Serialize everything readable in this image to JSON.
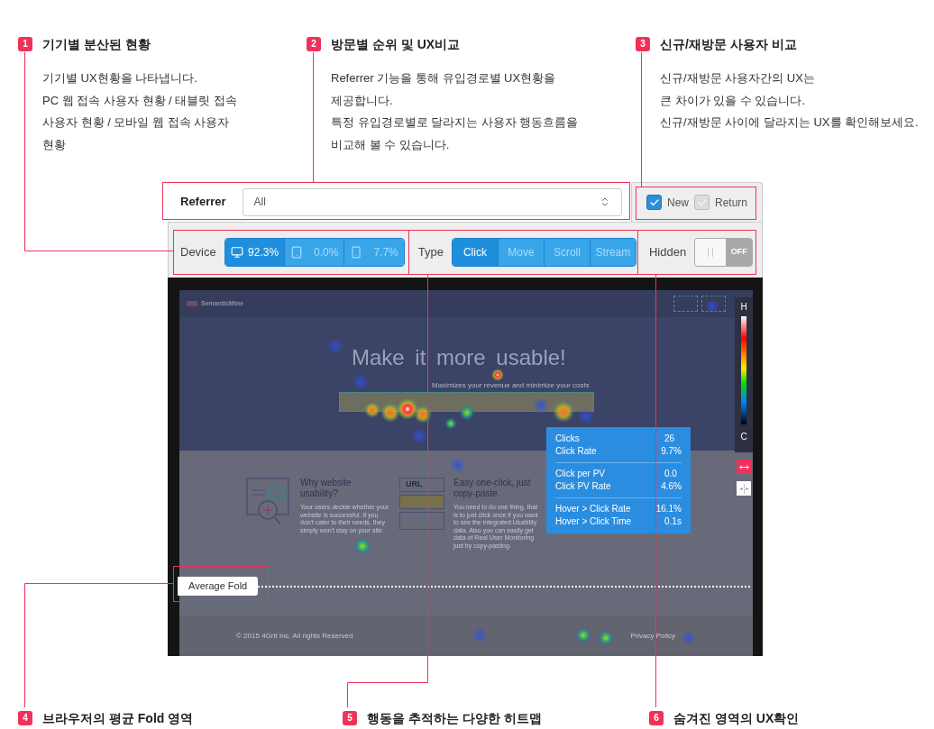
{
  "annotations_top": [
    {
      "number": "1",
      "title": "기기별 분산된 현황",
      "lines": [
        "기기별 UX현황을 나타냅니다.",
        "PC 웹 접속 사용자 현황 / 태블릿 접속",
        "사용자 현황 / 모바일 웹 접속 사용자",
        "현황"
      ]
    },
    {
      "number": "2",
      "title": "방문별 순위 및 UX비교",
      "lines": [
        "Referrer 기능을 통해 유입경로별 UX현황을",
        "제공합니다.",
        "특정 유입경로별로 달라지는 사용자 행동흐름을",
        "비교해 볼 수 있습니다."
      ]
    },
    {
      "number": "3",
      "title": "신규/재방문 사용자 비교",
      "lines": [
        "신규/재방문 사용자간의 UX는",
        "큰 차이가 있을 수 있습니다.",
        "신규/재방문 사이에 달라지는 UX를 확인해보세요."
      ]
    }
  ],
  "controls": {
    "referrer": {
      "label": "Referrer",
      "value": "All"
    },
    "visitors": [
      {
        "label": "New",
        "checked": true
      },
      {
        "label": "Return",
        "checked": false
      }
    ],
    "device": {
      "label": "Device",
      "options": [
        {
          "kind": "desktop",
          "value": "92.3%",
          "selected": true
        },
        {
          "kind": "tablet",
          "value": "0.0%",
          "selected": false
        },
        {
          "kind": "mobile",
          "value": "7.7%",
          "selected": false
        }
      ]
    },
    "type": {
      "label": "Type",
      "options": [
        {
          "label": "Click",
          "selected": true
        },
        {
          "label": "Move",
          "selected": false
        },
        {
          "label": "Scroll",
          "selected": false
        },
        {
          "label": "Stream",
          "selected": false
        }
      ]
    },
    "hidden": {
      "label": "Hidden",
      "on": false,
      "state_text": "OFF"
    }
  },
  "heatmap": {
    "page": {
      "brand": "SemanticMine",
      "headline": "Make it more usable!",
      "subline": "Maximizes your revenue and minimize your costs",
      "features": [
        {
          "kind": "usability",
          "title": "Why website usability?",
          "text": "Your users decide whether your website is successful. If you don't cater to their needs, they simply won't stay on your site."
        },
        {
          "kind": "url",
          "badge": "URL",
          "title": "Easy one-click, just copy-paste.",
          "text": "You need to do one thing, that is to just click once if you want to see the integrated Usability data. Also you can easily get data of Real User Monitoring just by copy-pasting."
        }
      ],
      "copyright": "© 2015 4Grit Inc. All rights Reserved",
      "footer_link": "Privacy Policy"
    },
    "legend": {
      "high": "H",
      "low": "C"
    },
    "tooltip": [
      [
        {
          "label": "Clicks",
          "value": "26"
        },
        {
          "label": "Click Rate",
          "value": "9.7%"
        }
      ],
      [
        {
          "label": "Click per PV",
          "value": "0.0"
        },
        {
          "label": "Click PV Rate",
          "value": "4.6%"
        }
      ],
      [
        {
          "label": "Hover > Click Rate",
          "value": "16.1%"
        },
        {
          "label": "Hover > Click Time",
          "value": "0.1s"
        }
      ]
    ],
    "fold_label": "Average Fold"
  },
  "annotations_bottom": [
    {
      "number": "4",
      "title": "브라우저의 평균 Fold 영역"
    },
    {
      "number": "5",
      "title": "행동을 추적하는 다양한 히트맵"
    },
    {
      "number": "6",
      "title": "숨겨진 영역의 UX확인"
    }
  ]
}
